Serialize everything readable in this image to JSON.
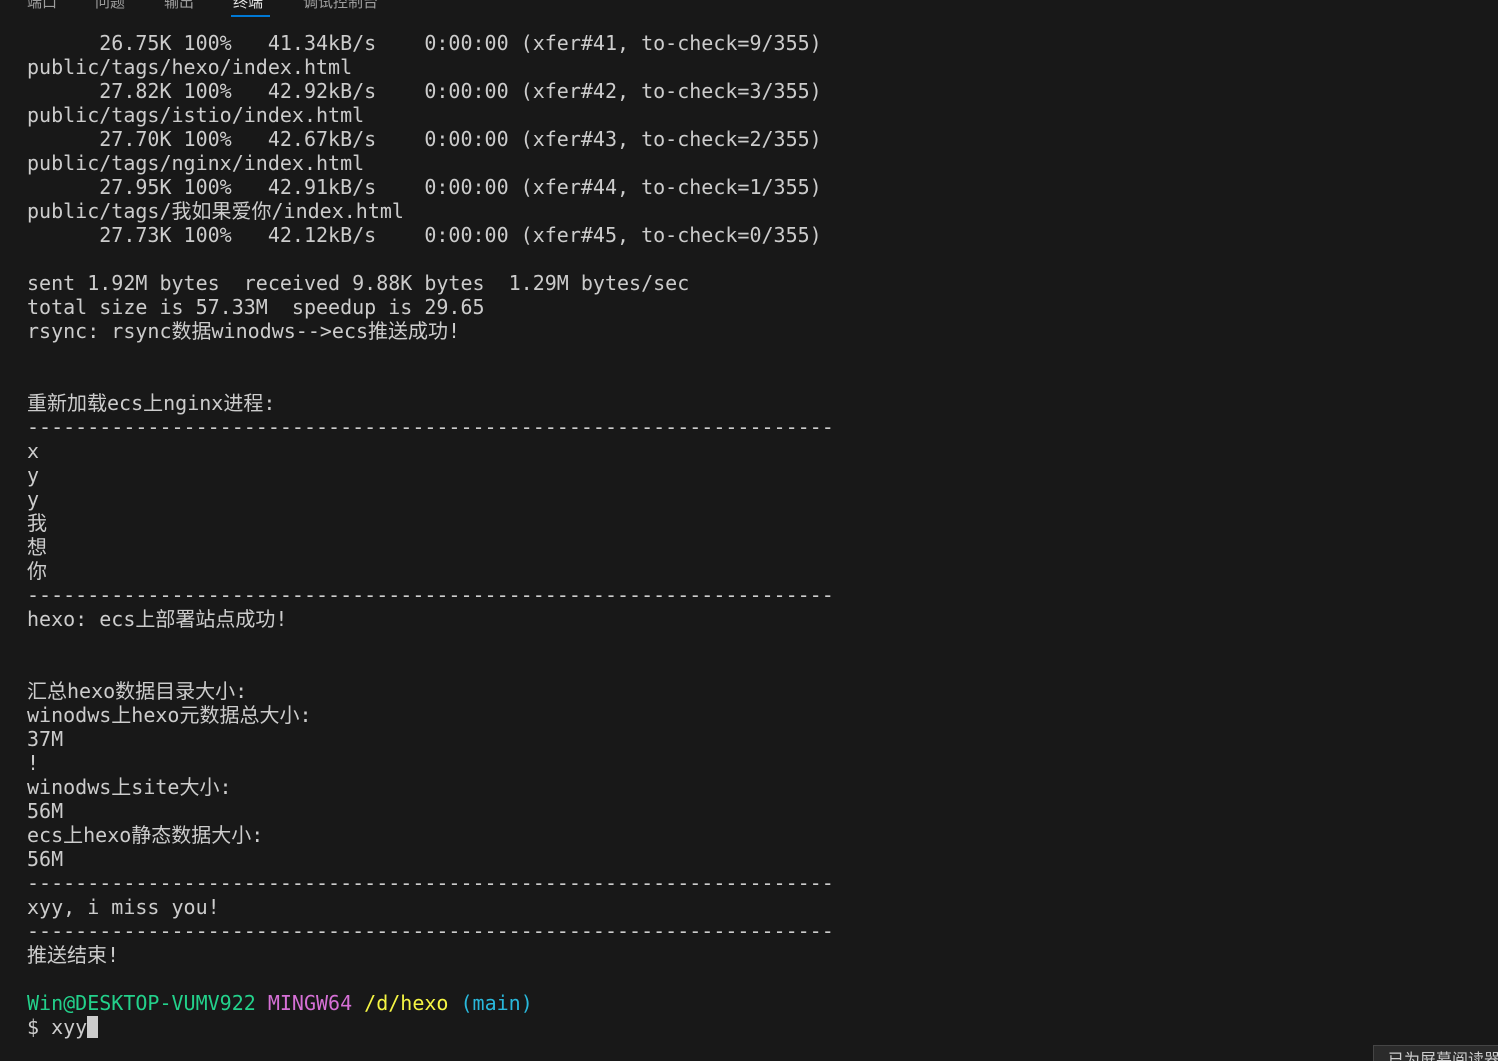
{
  "tabs": [
    "端口",
    "问题",
    "输出",
    "终端",
    "调试控制台"
  ],
  "active_tab": "终端",
  "terminal_lines": [
    "      26.75K 100%   41.34kB/s    0:00:00 (xfer#41, to-check=9/355)",
    "public/tags/hexo/index.html",
    "      27.82K 100%   42.92kB/s    0:00:00 (xfer#42, to-check=3/355)",
    "public/tags/istio/index.html",
    "      27.70K 100%   42.67kB/s    0:00:00 (xfer#43, to-check=2/355)",
    "public/tags/nginx/index.html",
    "      27.95K 100%   42.91kB/s    0:00:00 (xfer#44, to-check=1/355)",
    "public/tags/我如果爱你/index.html",
    "      27.73K 100%   42.12kB/s    0:00:00 (xfer#45, to-check=0/355)",
    "",
    "sent 1.92M bytes  received 9.88K bytes  1.29M bytes/sec",
    "total size is 57.33M  speedup is 29.65",
    "rsync: rsync数据winodws-->ecs推送成功!",
    "",
    "",
    "重新加载ecs上nginx进程:",
    "-------------------------------------------------------------------",
    "x",
    "y",
    "y",
    "我",
    "想",
    "你",
    "-------------------------------------------------------------------",
    "hexo: ecs上部署站点成功!",
    "",
    "",
    "汇总hexo数据目录大小:",
    "winodws上hexo元数据总大小:",
    "37M",
    "!",
    "winodws上site大小:",
    "56M",
    "ecs上hexo静态数据大小:",
    "56M",
    "-------------------------------------------------------------------",
    "xyy, i miss you!",
    "-------------------------------------------------------------------",
    "推送结束!",
    ""
  ],
  "prompt": {
    "user_host": "Win@DESKTOP-VUMV922",
    "system": "MINGW64",
    "path": "/d/hexo",
    "branch": "(main)",
    "symbol": "$",
    "command": "xyy"
  },
  "tooltip_text": "已为屏幕阅读器",
  "colors": {
    "background": "#181818",
    "text": "#cccccc",
    "user_host": "#23d18b",
    "system": "#d670d6",
    "path": "#f5f543",
    "branch": "#29b8db",
    "active_tab_indicator": "#0078d4"
  }
}
